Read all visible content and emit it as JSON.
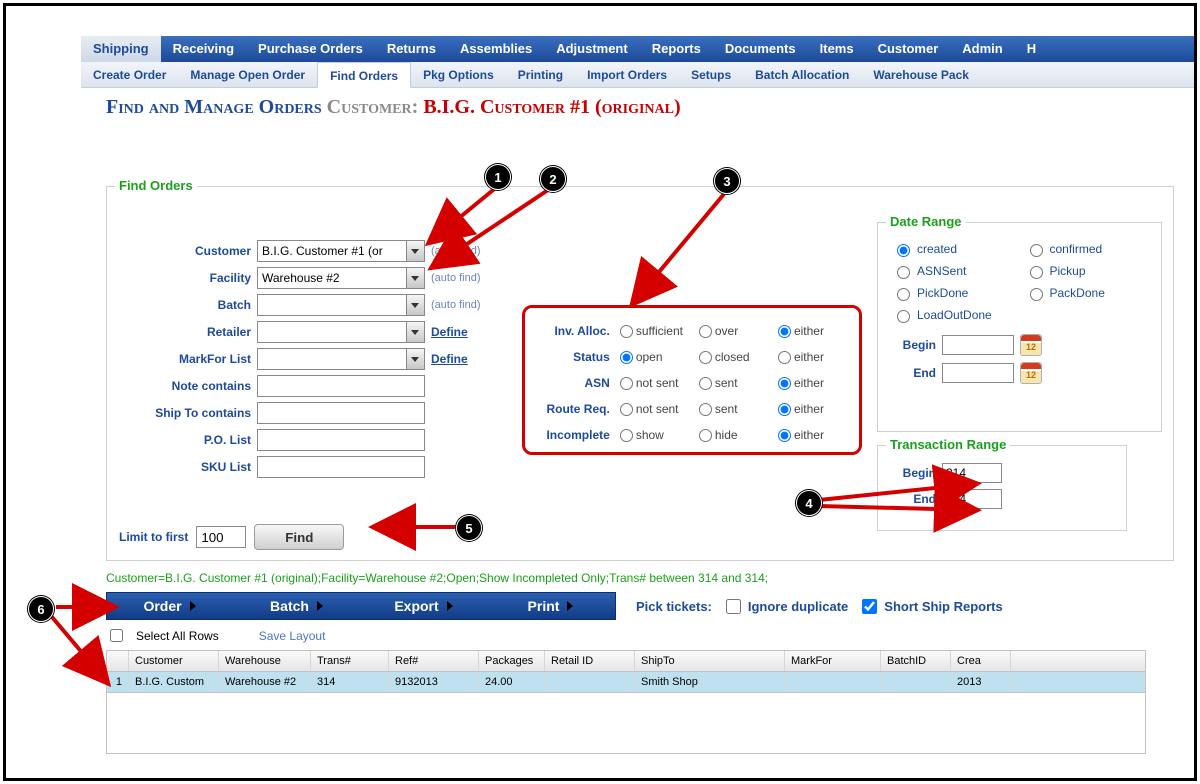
{
  "topnav": [
    "Shipping",
    "Receiving",
    "Purchase Orders",
    "Returns",
    "Assemblies",
    "Adjustment",
    "Reports",
    "Documents",
    "Items",
    "Customer",
    "Admin",
    "H"
  ],
  "topnav_active": 0,
  "subnav": [
    "Create Order",
    "Manage Open Order",
    "Find Orders",
    "Pkg Options",
    "Printing",
    "Import Orders",
    "Setups",
    "Batch Allocation",
    "Warehouse Pack"
  ],
  "subnav_active": 2,
  "page_title": {
    "a": "Find and Manage Orders",
    "b": "Customer:",
    "c": "B.I.G. Customer #1 (original)"
  },
  "find_orders_legend": "Find Orders",
  "form": {
    "customer_label": "Customer",
    "customer_value": "B.I.G. Customer #1 (or",
    "facility_label": "Facility",
    "facility_value": "Warehouse #2",
    "batch_label": "Batch",
    "batch_value": "",
    "retailer_label": "Retailer",
    "markfor_label": "MarkFor List",
    "note_label": "Note contains",
    "shipto_label": "Ship To contains",
    "po_label": "P.O. List",
    "sku_label": "SKU List",
    "auto_find": "(auto find)",
    "define": "Define"
  },
  "filters": {
    "invalloc": {
      "label": "Inv. Alloc.",
      "o1": "sufficient",
      "o2": "over",
      "o3": "either",
      "sel": "o3"
    },
    "status": {
      "label": "Status",
      "o1": "open",
      "o2": "closed",
      "o3": "either",
      "sel": "o1"
    },
    "asn": {
      "label": "ASN",
      "o1": "not sent",
      "o2": "sent",
      "o3": "either",
      "sel": "o3"
    },
    "route": {
      "label": "Route Req.",
      "o1": "not sent",
      "o2": "sent",
      "o3": "either",
      "sel": "o3"
    },
    "incomp": {
      "label": "Incomplete",
      "o1": "show",
      "o2": "hide",
      "o3": "either",
      "sel": "o3"
    }
  },
  "date_range": {
    "legend": "Date Range",
    "opts": [
      "created",
      "confirmed",
      "ASNSent",
      "Pickup",
      "PickDone",
      "PackDone",
      "LoadOutDone"
    ],
    "selected": "created",
    "begin_label": "Begin",
    "end_label": "End"
  },
  "trans_range": {
    "legend": "Transaction Range",
    "begin_label": "Begin",
    "end_label": "End",
    "begin": "314",
    "end": "314"
  },
  "limit": {
    "label": "Limit to first",
    "value": "100",
    "find": "Find"
  },
  "query": "Customer=B.I.G. Customer #1 (original);Facility=Warehouse #2;Open;Show Incompleted Only;Trans# between 314 and 314;",
  "actions": [
    "Order",
    "Batch",
    "Export",
    "Print"
  ],
  "pick": {
    "label": "Pick tickets:",
    "ignore": "Ignore duplicate",
    "short": "Short Ship Reports"
  },
  "selall": {
    "label": "Select All Rows",
    "save": "Save Layout"
  },
  "grid": {
    "headers": [
      "",
      "Customer",
      "Warehouse",
      "Trans#",
      "Ref#",
      "Packages",
      "Retail ID",
      "ShipTo",
      "MarkFor",
      "BatchID",
      "Crea"
    ],
    "row": {
      "idx": "1",
      "customer": "B.I.G. Custom",
      "warehouse": "Warehouse #2",
      "trans": "314",
      "ref": "9132013",
      "packages": "24.00",
      "retail": "",
      "shipto": "Smith Shop",
      "markfor": "",
      "batch": "",
      "crea": "2013"
    }
  },
  "callouts": {
    "1": "1",
    "2": "2",
    "3": "3",
    "4": "4",
    "5": "5",
    "6": "6"
  }
}
